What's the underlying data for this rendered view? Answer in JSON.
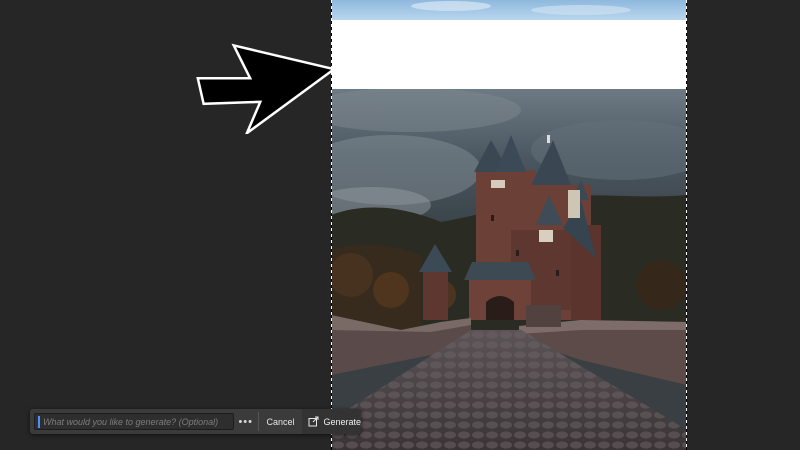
{
  "app": {
    "canvas_bg": "#262626",
    "generative_fill_bar": {
      "prompt_value": "",
      "prompt_placeholder": "What would you like to generate? (Optional)",
      "more_icon": "ellipsis-icon",
      "more_label": "•••",
      "cancel_label": "Cancel",
      "generate_label": "Generate",
      "generate_icon": "generate-icon"
    }
  },
  "document": {
    "sky_strip_color": "#a9cbe6",
    "selection_fill_color": "#ffffff",
    "photo": "castle-icon"
  },
  "annotation": {
    "arrow_icon": "arrow-right-icon",
    "arrow_color": "#000000",
    "arrow_outline": "#ffffff"
  }
}
